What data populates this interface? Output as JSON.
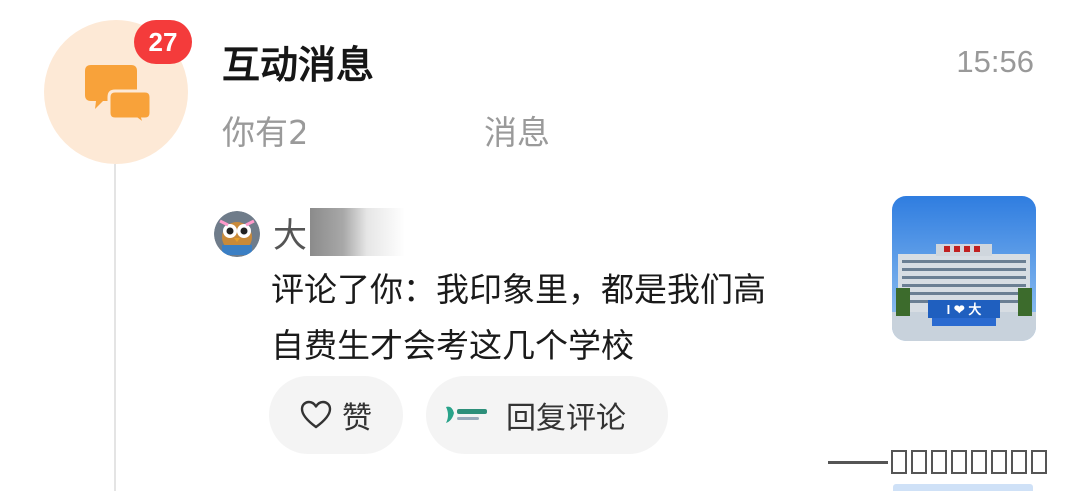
{
  "conversation": {
    "unread_badge": "27",
    "title": "互动消息",
    "time": "15:56",
    "subtitle_prefix": "你有2",
    "subtitle_suffix": "消息",
    "icon": "chat-bubbles-icon"
  },
  "comment": {
    "username": "大",
    "text_line1": "评论了你：我印象里，都是我们高",
    "text_line2": "自费生才会考这几个学校"
  },
  "actions": {
    "like_label": "赞",
    "like_icon": "heart-outline-icon",
    "reply_label": "回复评论"
  },
  "thumbnail": {
    "sign_text": "I ❤ 大"
  },
  "colors": {
    "badge": "#f43b3b",
    "avatar_bg": "#fde9d6",
    "icon_orange": "#f8a23a",
    "muted_text": "#9a9a9a",
    "pill_bg": "#f4f4f4"
  }
}
